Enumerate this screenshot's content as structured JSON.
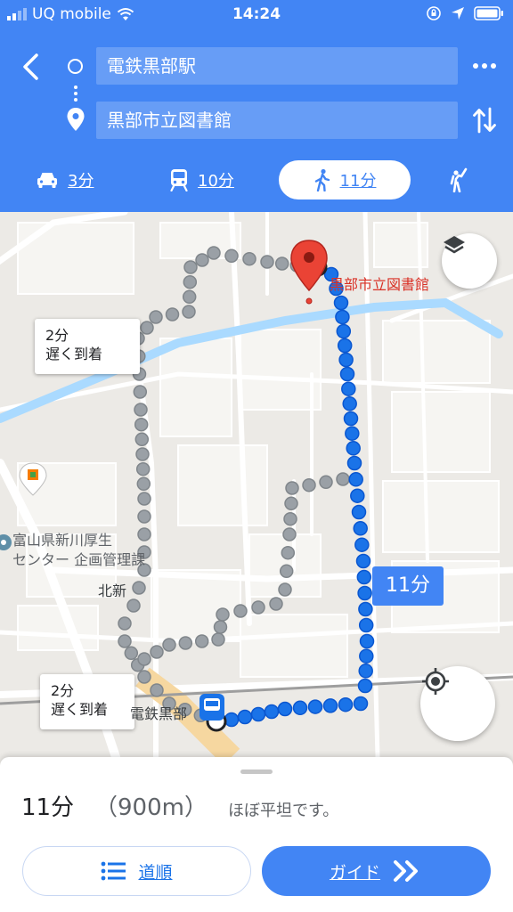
{
  "status_bar": {
    "carrier": "UQ mobile",
    "time": "14:24"
  },
  "route": {
    "origin": "電鉄黒部駅",
    "destination": "黒部市立図書館"
  },
  "travel_modes": [
    {
      "name": "car",
      "time": "3分",
      "selected": false
    },
    {
      "name": "transit",
      "time": "10分",
      "selected": false
    },
    {
      "name": "walk",
      "time": "11分",
      "selected": true
    },
    {
      "name": "ride-hailing",
      "time": "",
      "selected": false
    }
  ],
  "map": {
    "destination_label": "黒部市立図書館",
    "poi_hospital_line1": "富山県新川厚生",
    "poi_hospital_line2": "センター 企画管理課",
    "area_label": "北新",
    "station_label": "電鉄黒部",
    "route_eta_badge": "11分",
    "alternatives": [
      {
        "time": "2分",
        "note": "遅く到着"
      },
      {
        "time": "2分",
        "note": "遅く到着"
      }
    ]
  },
  "summary": {
    "duration": "11分",
    "distance": "（900m）",
    "note": "ほぼ平坦です。",
    "steps_label": "道順",
    "guide_label": "ガイド"
  },
  "colors": {
    "header": "#4285f4",
    "route_active": "#1a73e8",
    "route_alternative": "#9aa0a6",
    "destination_pin": "#ea4335",
    "water": "#aadaff"
  }
}
